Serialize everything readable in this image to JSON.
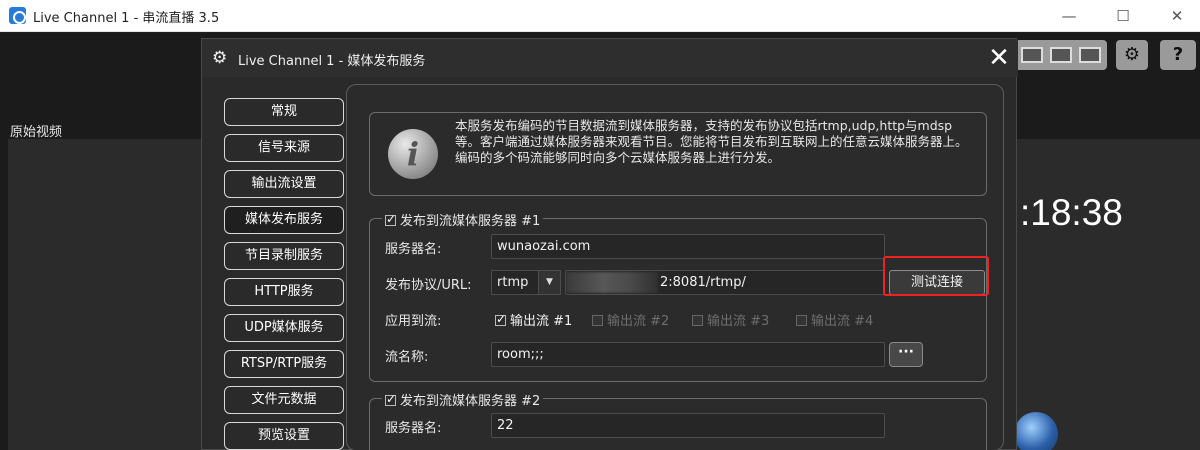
{
  "window": {
    "title": "Live Channel 1 - 串流直播 3.5",
    "controls": [
      "—",
      "☐",
      "✕"
    ]
  },
  "app": {
    "source_label": "原始视频",
    "clock_text": ":18:38",
    "toolbar_buttons": [
      "⚙",
      "?"
    ]
  },
  "dialog": {
    "title": "Live Channel 1 - 媒体发布服务",
    "close_symbol": "✕",
    "nav": [
      {
        "label": "常规"
      },
      {
        "label": "信号来源"
      },
      {
        "label": "输出流设置"
      },
      {
        "label": "媒体发布服务",
        "active": true
      },
      {
        "label": "节目录制服务"
      },
      {
        "label": "HTTP服务"
      },
      {
        "label": "UDP媒体服务"
      },
      {
        "label": "RTSP/RTP服务"
      },
      {
        "label": "文件元数据"
      },
      {
        "label": "预览设置"
      }
    ],
    "info": {
      "icon": "i",
      "text": "本服务发布编码的节目数据流到媒体服务器，支持的发布协议包括rtmp,udp,http与mdsp等。客户端通过媒体服务器来观看节目。您能将节目发布到互联网上的任意云媒体服务器上。编码的多个码流能够同时向多个云媒体服务器上进行分发。"
    },
    "server1": {
      "legend": "发布到流媒体服务器 #1",
      "enabled": true,
      "server_name_label": "服务器名:",
      "server_name_value": "wunaozai.com",
      "protocol_label": "发布协议/URL:",
      "protocol_value": "rtmp",
      "url_value": "2:8081/rtmp/",
      "test_button": "测试连接",
      "apply_label": "应用到流:",
      "streams": [
        {
          "label": "输出流 #1",
          "checked": true
        },
        {
          "label": "输出流 #2",
          "checked": false
        },
        {
          "label": "输出流 #3",
          "checked": false
        },
        {
          "label": "输出流 #4",
          "checked": false
        }
      ],
      "stream_name_label": "流名称:",
      "stream_name_value": "room;;;",
      "more_button": "···"
    },
    "server2": {
      "legend": "发布到流媒体服务器 #2",
      "enabled": true,
      "server_name_label": "服务器名:",
      "server_name_value": "22"
    }
  },
  "colors": {
    "highlight": "#e22222",
    "dialog_bg": "#2a2a2a"
  }
}
